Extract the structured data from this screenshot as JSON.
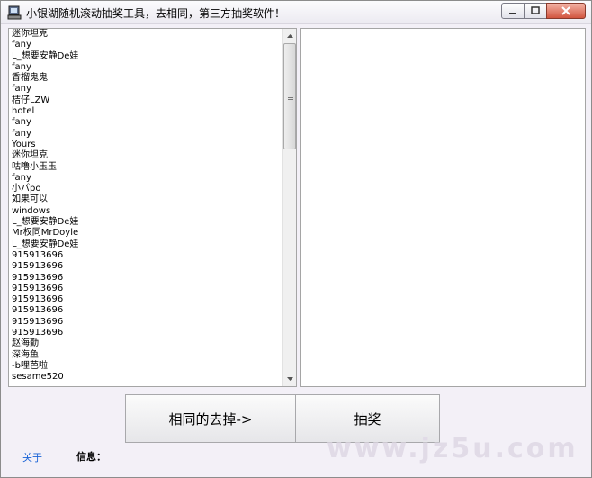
{
  "window": {
    "title": "小银湖随机滚动抽奖工具，去相同，第三方抽奖软件！"
  },
  "names_list": [
    "迷你坦克",
    "fany",
    "L_想要安静De娃",
    "fany",
    "香榴鬼鬼",
    "fany",
    "桔仔LZW",
    "hotel",
    "fany",
    "fany",
    "Yours",
    "迷你坦克",
    "咕噜小玉玉",
    "fany",
    "小パpo",
    "如果可以",
    "windows",
    "L_想要安静De娃",
    "Mr权同MrDoyle",
    "L_想要安静De娃",
    "915913696",
    "915913696",
    "915913696",
    "915913696",
    "915913696",
    "915913696",
    "915913696",
    "915913696",
    "赵海勤",
    "深海鱼",
    "-b哩芭啦",
    "sesame520"
  ],
  "buttons": {
    "dedupe_label": "相同的去掉->",
    "draw_label": "抽奖"
  },
  "footer": {
    "about_label": "关于",
    "info_label": "信息："
  },
  "watermark": "www.jz5u.com",
  "colors": {
    "window_bg": "#f3f0f7",
    "link": "#1a63d6",
    "close_button": "#d2553f"
  }
}
